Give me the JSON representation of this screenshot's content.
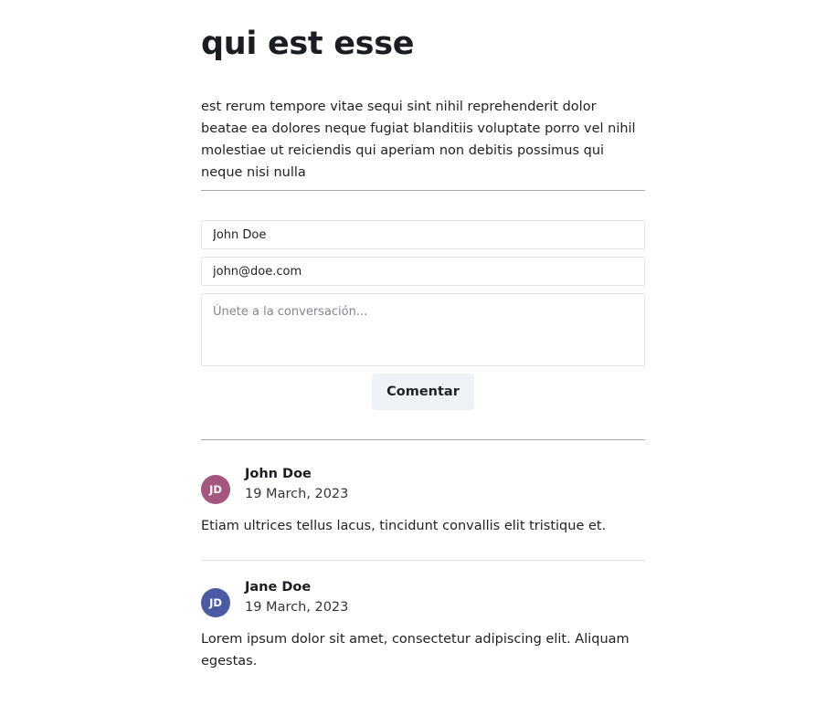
{
  "post": {
    "title": "qui est esse",
    "body": "est rerum tempore vitae sequi sint nihil reprehenderit dolor beatae ea dolores neque fugiat blanditiis voluptate porro vel nihil molestiae ut reiciendis qui aperiam non debitis possimus qui neque nisi nulla"
  },
  "form": {
    "name_value": "John Doe",
    "email_value": "john@doe.com",
    "comment_placeholder": "Únete a la conversación...",
    "submit_label": "Comentar"
  },
  "comments": [
    {
      "initials": "JD",
      "name": "John Doe",
      "date": "19 March, 2023",
      "text": "Etiam ultrices tellus lacus, tincidunt convallis elit tristique et.",
      "avatar_color": "#a3577e"
    },
    {
      "initials": "JD",
      "name": "Jane Doe",
      "date": "19 March, 2023",
      "text": "Lorem ipsum dolor sit amet, consectetur adipiscing elit. Aliquam egestas.",
      "avatar_color": "#4a5ba3"
    }
  ]
}
